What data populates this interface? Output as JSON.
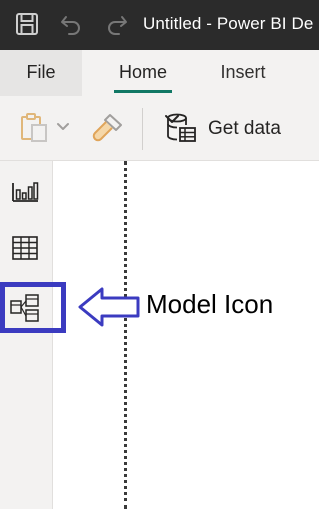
{
  "titlebar": {
    "title": "Untitled - Power BI De",
    "icons": [
      "save-icon",
      "undo-icon",
      "redo-icon"
    ],
    "background": "#2b2b2b"
  },
  "ribbon_tabs": [
    {
      "label": "File"
    },
    {
      "label": "Home",
      "selected": true
    },
    {
      "label": "Insert"
    }
  ],
  "toolbar": {
    "paste_icon": "paste-icon",
    "format_painter_icon": "format-painter-icon",
    "get_data_label": "Get data",
    "get_data_icon": "database-icon"
  },
  "viewbar": {
    "items": [
      {
        "icon": "report-view-icon"
      },
      {
        "icon": "data-view-icon"
      },
      {
        "icon": "model-view-icon",
        "highlighted": true
      }
    ]
  },
  "annotation": {
    "text": "Model Icon",
    "color": "#3b3bc0"
  },
  "colors": {
    "accent_underline": "#117865",
    "highlight_box": "#3b3bc0"
  }
}
